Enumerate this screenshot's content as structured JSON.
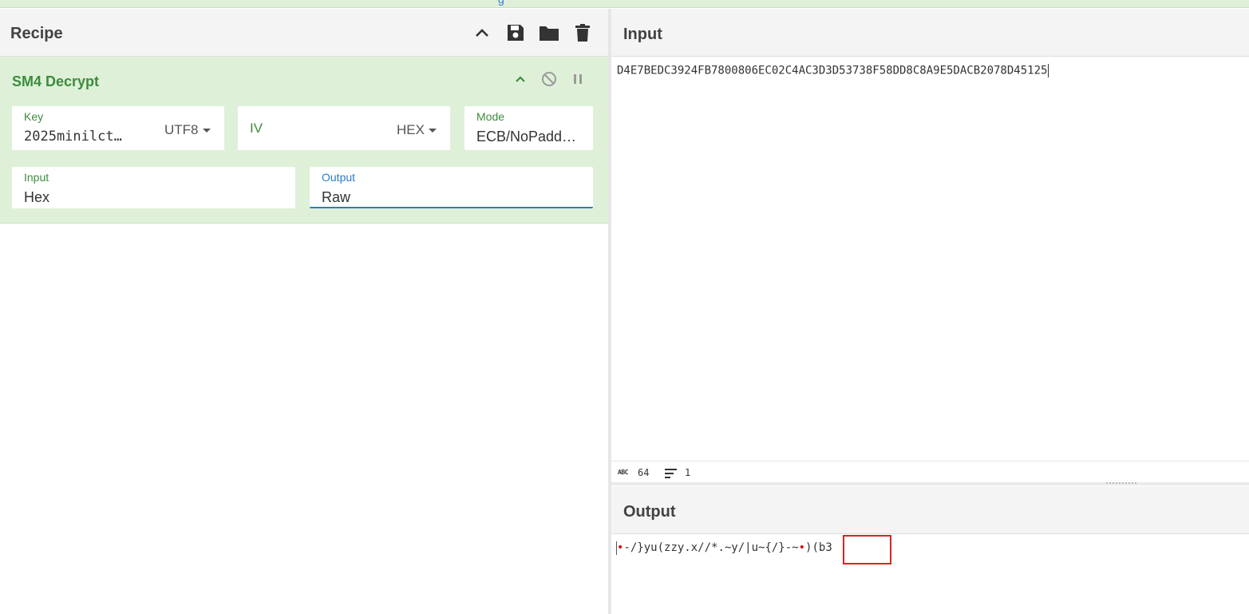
{
  "recipe": {
    "title": "Recipe",
    "operation": {
      "title": "SM4 Decrypt",
      "key": {
        "label": "Key",
        "value": "2025minilct…",
        "encoding": "UTF8"
      },
      "iv": {
        "label": "IV",
        "value": "",
        "encoding": "HEX"
      },
      "mode": {
        "label": "Mode",
        "value": "ECB/NoPadd…"
      },
      "input_format": {
        "label": "Input",
        "value": "Hex"
      },
      "output_format": {
        "label": "Output",
        "value": "Raw"
      }
    }
  },
  "input": {
    "title": "Input",
    "text": "D4E7BEDC3924FB7800806EC02C4AC3D3D53738F58DD8C8A9E5DACB2078D45125",
    "status": {
      "length": "64",
      "lines": "1"
    }
  },
  "output": {
    "title": "Output",
    "prefix_dot": "•",
    "text_mid": "-/}yu(zzy.x//*.~y/|u~{/}-~",
    "mid_dot": "•",
    "text_end": ")(b3"
  },
  "topstrip_char": "g",
  "colors": {
    "op_bg": "#dff0d8",
    "op_title": "#3c8c3c",
    "active_field": "#2b7bc9",
    "highlight": "#e02020"
  },
  "icons": [
    "chevron-up-icon",
    "save-icon",
    "folder-icon",
    "trash-icon",
    "disable-icon",
    "pause-icon",
    "abc-icon",
    "lines-icon"
  ]
}
